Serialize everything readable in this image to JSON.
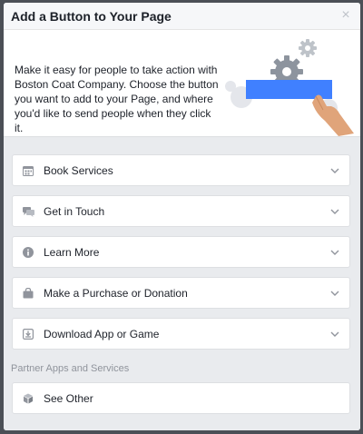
{
  "dialog": {
    "title": "Add a Button to Your Page",
    "close_glyph": "×",
    "intro": "Make it easy for people to take action with Boston Coat Company. Choose the button you want to add to your Page, and where you'd like to send people when they click it."
  },
  "options": [
    {
      "label": "Book Services",
      "icon": "calendar-icon"
    },
    {
      "label": "Get in Touch",
      "icon": "chat-icon"
    },
    {
      "label": "Learn More",
      "icon": "info-icon"
    },
    {
      "label": "Make a Purchase or Donation",
      "icon": "shopping-bag-icon"
    },
    {
      "label": "Download App or Game",
      "icon": "download-icon"
    }
  ],
  "partner": {
    "section_label": "Partner Apps and Services",
    "see_other_label": "See Other",
    "see_other_icon": "cube-icon"
  },
  "colors": {
    "accent": "#4080ff",
    "backdrop": "#4b4f56",
    "panel": "#e9ebee",
    "hand": "#e0a47a"
  }
}
